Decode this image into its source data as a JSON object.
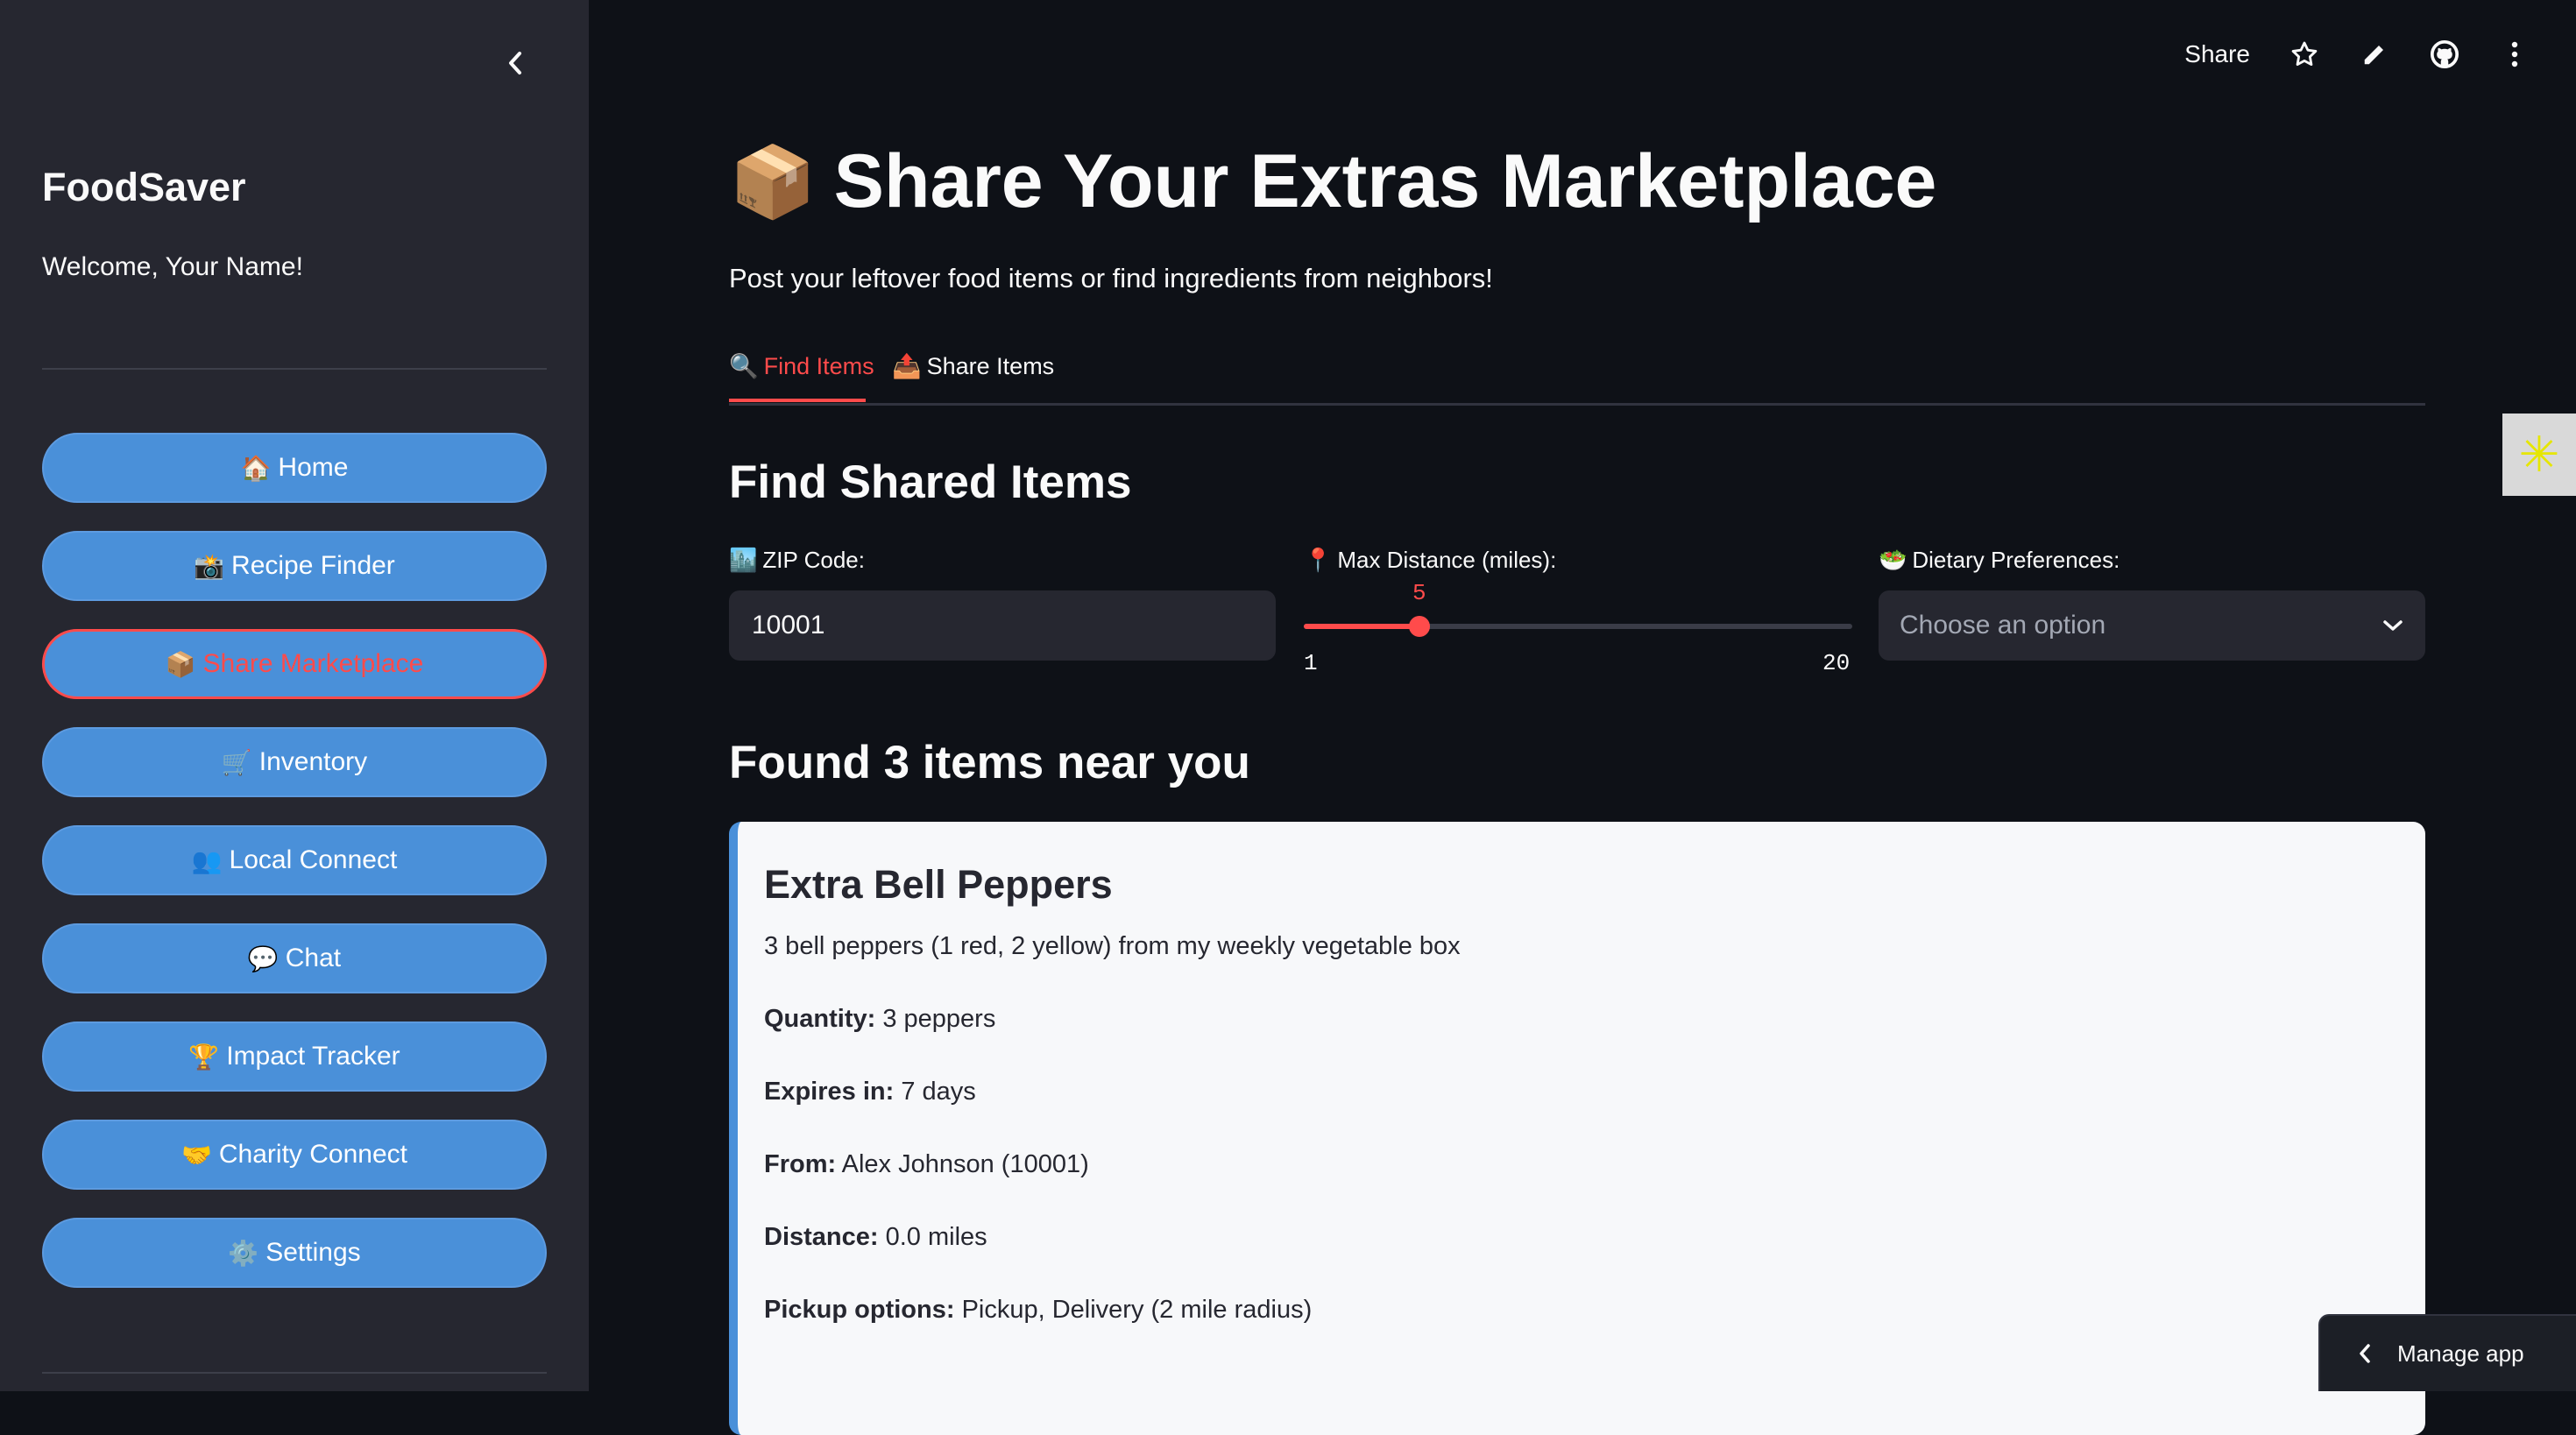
{
  "sidebar": {
    "app_name": "FoodSaver",
    "welcome": "Welcome, Your Name!",
    "items": [
      {
        "emoji": "🏠",
        "label": "Home"
      },
      {
        "emoji": "📸",
        "label": "Recipe Finder"
      },
      {
        "emoji": "📦",
        "label": "Share Marketplace",
        "active": true
      },
      {
        "emoji": "🛒",
        "label": "Inventory"
      },
      {
        "emoji": "👥",
        "label": "Local Connect"
      },
      {
        "emoji": "💬",
        "label": "Chat"
      },
      {
        "emoji": "🏆",
        "label": "Impact Tracker"
      },
      {
        "emoji": "🤝",
        "label": "Charity Connect"
      },
      {
        "emoji": "⚙️",
        "label": "Settings"
      }
    ]
  },
  "topbar": {
    "share_label": "Share"
  },
  "page": {
    "title_emoji": "📦",
    "title": "Share Your Extras Marketplace",
    "subtitle": "Post your leftover food items or find ingredients from neighbors!"
  },
  "tabs": [
    {
      "emoji": "🔍",
      "label": "Find Items",
      "active": true
    },
    {
      "emoji": "📤",
      "label": "Share Items",
      "active": false
    }
  ],
  "find": {
    "heading": "Find Shared Items",
    "zip": {
      "emoji": "🏙️",
      "label": "ZIP Code:",
      "value": "10001"
    },
    "distance": {
      "emoji": "📍",
      "label": "Max Distance (miles):",
      "value": 5,
      "min": 1,
      "max": 20
    },
    "diet": {
      "emoji": "🥗",
      "label": "Dietary Preferences:",
      "placeholder": "Choose an option"
    }
  },
  "results": {
    "heading": "Found 3 items near you",
    "items": [
      {
        "title": "Extra Bell Peppers",
        "description": "3 bell peppers (1 red, 2 yellow) from my weekly vegetable box",
        "quantity_label": "Quantity:",
        "quantity": "3 peppers",
        "expires_label": "Expires in:",
        "expires": "7 days",
        "from_label": "From:",
        "from": "Alex Johnson (10001)",
        "distance_label": "Distance:",
        "distance": "0.0 miles",
        "pickup_label": "Pickup options:",
        "pickup": "Pickup, Delivery (2 mile radius)"
      }
    ]
  },
  "manage_app": {
    "label": "Manage app"
  },
  "side_badge_glyph": "✳"
}
